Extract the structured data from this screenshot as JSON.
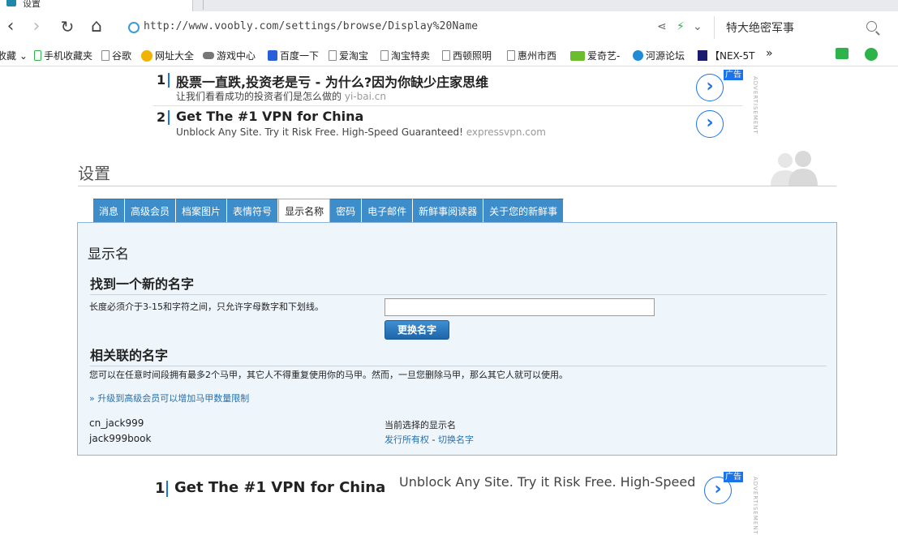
{
  "browser": {
    "tab_title": "设置",
    "url": "http://www.voobly.com/settings/browse/Display%20Name",
    "search_query": "特大绝密军事",
    "nav": {
      "back": "‹",
      "forward": "›",
      "reload": "↻",
      "home": "⌂"
    },
    "bookmarks": [
      {
        "label": "收藏 ⌄",
        "icon": "none"
      },
      {
        "label": "手机收藏夹",
        "icon": "phone-icon"
      },
      {
        "label": "谷歌",
        "icon": "doc-icon"
      },
      {
        "label": "网址大全",
        "icon": "globe-icon"
      },
      {
        "label": "游戏中心",
        "icon": "gamepad-icon"
      },
      {
        "label": "百度一下",
        "icon": "baidu-icon"
      },
      {
        "label": "爱淘宝",
        "icon": "doc-icon"
      },
      {
        "label": "淘宝特卖",
        "icon": "doc-icon"
      },
      {
        "label": "西顿照明",
        "icon": "doc-icon"
      },
      {
        "label": "惠州市西",
        "icon": "doc-icon"
      },
      {
        "label": "爱奇艺-",
        "icon": "iqiyi-icon"
      },
      {
        "label": "河源论坛",
        "icon": "globe-icon"
      },
      {
        "label": "【NEX-5T",
        "icon": "z-icon"
      }
    ],
    "bookmarks_more": "»"
  },
  "top_ads": [
    {
      "num": "1",
      "title": "股票一直跌,投资老是亏 - 为什么?因为你缺少庄家思维",
      "desc": "让我们看看成功的投资者们是怎么做的",
      "domain": "yi-bai.cn"
    },
    {
      "num": "2",
      "title": "Get The #1 VPN for China",
      "desc": "Unblock Any Site. Try it Risk Free. High-Speed Guaranteed!",
      "domain": "expressvpn.com"
    }
  ],
  "ad_tag": "广告",
  "ad_vertical": "ADVERTISEMENT",
  "page": {
    "title": "设置",
    "tabs": [
      {
        "label": "消息",
        "active": false
      },
      {
        "label": "高级会员",
        "active": false
      },
      {
        "label": "档案图片",
        "active": false
      },
      {
        "label": "表情符号",
        "active": false
      },
      {
        "label": "显示名称",
        "active": true
      },
      {
        "label": "密码",
        "active": false
      },
      {
        "label": "电子邮件",
        "active": false
      },
      {
        "label": "新鲜事阅读器",
        "active": false
      },
      {
        "label": "关于您的新鲜事",
        "active": false
      }
    ],
    "panel_heading": "显示名",
    "new_name": {
      "heading": "找到一个新的名字",
      "hint": "长度必须介于3-15和字符之间，只允许字母数字和下划线。",
      "input_value": "",
      "button_label": "更换名字"
    },
    "aliases": {
      "heading": "相关联的名字",
      "desc": "您可以在任意时间段拥有最多2个马甲，其它人不得重复使用你的马甲。然而，一旦您删除马甲，那么其它人就可以使用。",
      "upgrade_link": "» 升级到高级会员可以增加马甲数量限制",
      "rows": [
        {
          "name": "cn_jack999",
          "status": "当前选择的显示名"
        },
        {
          "name": "jack999book",
          "action_1": "发行所有权",
          "sep": " - ",
          "action_2": "切换名字"
        }
      ]
    }
  },
  "bottom_ad": {
    "num": "1",
    "title": "Get The #1 VPN for China",
    "desc": "Unblock Any Site. Try it Risk Free. High-Speed"
  }
}
